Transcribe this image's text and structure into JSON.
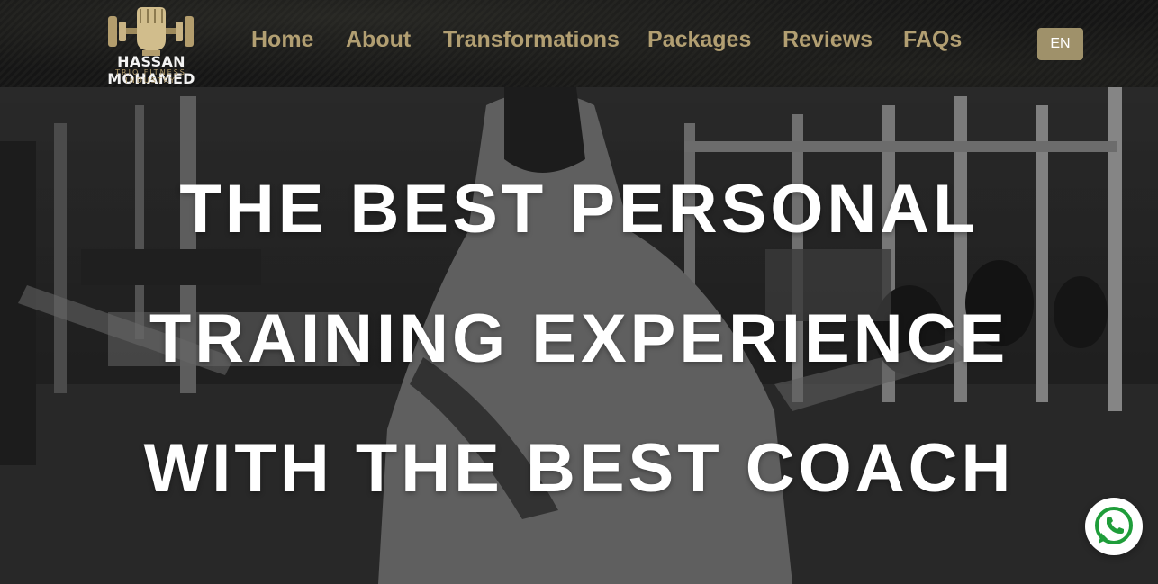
{
  "brand": {
    "name": "HASSAN MOHAMED",
    "subtitle_line1": "TRIO FITNESS",
    "subtitle_line2": "INDUSTRY",
    "accent_color": "#b29f72"
  },
  "nav": {
    "items": [
      {
        "label": "Home"
      },
      {
        "label": "About"
      },
      {
        "label": "Transformations"
      },
      {
        "label": "Packages"
      },
      {
        "label": "Reviews"
      },
      {
        "label": "FAQs"
      }
    ]
  },
  "language": {
    "label": "EN",
    "color": "#9f916a"
  },
  "hero": {
    "line1": "THE BEST PERSONAL",
    "line2": "TRAINING EXPERIENCE",
    "line3": "WITH THE BEST COACH"
  },
  "floating": {
    "whatsapp_icon": "whatsapp-icon",
    "whatsapp_color": "#1f9d3a"
  }
}
